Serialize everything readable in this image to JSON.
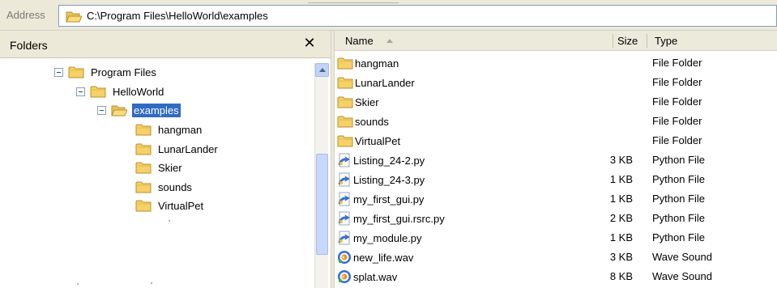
{
  "address_bar": {
    "label": "Address",
    "path": "C:\\Program Files\\HelloWorld\\examples"
  },
  "folders_pane": {
    "title": "Folders",
    "close_symbol": "✕",
    "tree": [
      {
        "label": "Program Files",
        "icon": "folder-icon",
        "expanded": true
      },
      {
        "label": "HelloWorld",
        "icon": "folder-icon",
        "expanded": true
      },
      {
        "label": "examples",
        "icon": "open-folder-icon",
        "expanded": true,
        "selected": true
      },
      {
        "label": "hangman",
        "icon": "folder-icon"
      },
      {
        "label": "LunarLander",
        "icon": "folder-icon"
      },
      {
        "label": "Skier",
        "icon": "folder-icon"
      },
      {
        "label": "sounds",
        "icon": "folder-icon"
      },
      {
        "label": "VirtualPet",
        "icon": "folder-icon"
      }
    ]
  },
  "file_list": {
    "columns": {
      "name": "Name",
      "size": "Size",
      "type": "Type"
    },
    "sort": "name-ascending",
    "rows": [
      {
        "name": "hangman",
        "size": "",
        "type": "File Folder",
        "icon": "folder-icon"
      },
      {
        "name": "LunarLander",
        "size": "",
        "type": "File Folder",
        "icon": "folder-icon"
      },
      {
        "name": "Skier",
        "size": "",
        "type": "File Folder",
        "icon": "folder-icon"
      },
      {
        "name": "sounds",
        "size": "",
        "type": "File Folder",
        "icon": "folder-icon"
      },
      {
        "name": "VirtualPet",
        "size": "",
        "type": "File Folder",
        "icon": "folder-icon"
      },
      {
        "name": "Listing_24-2.py",
        "size": "3 KB",
        "type": "Python File",
        "icon": "python-file-icon"
      },
      {
        "name": "Listing_24-3.py",
        "size": "1 KB",
        "type": "Python File",
        "icon": "python-file-icon"
      },
      {
        "name": "my_first_gui.py",
        "size": "1 KB",
        "type": "Python File",
        "icon": "python-file-icon"
      },
      {
        "name": "my_first_gui.rsrc.py",
        "size": "2 KB",
        "type": "Python File",
        "icon": "python-file-icon"
      },
      {
        "name": "my_module.py",
        "size": "1 KB",
        "type": "Python File",
        "icon": "python-file-icon"
      },
      {
        "name": "new_life.wav",
        "size": "3 KB",
        "type": "Wave Sound",
        "icon": "wave-sound-icon"
      },
      {
        "name": "splat.wav",
        "size": "8 KB",
        "type": "Wave Sound",
        "icon": "wave-sound-icon"
      }
    ]
  },
  "colors": {
    "chrome": "#ece9d8",
    "selection": "#316ac5",
    "folder_yellow": "#f5d167"
  }
}
